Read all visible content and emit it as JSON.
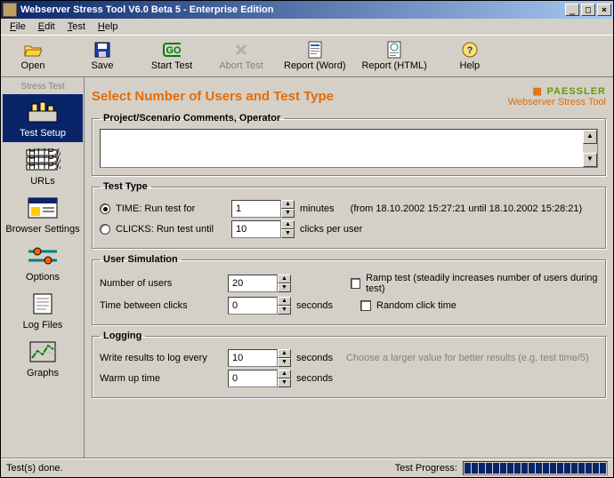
{
  "window": {
    "title": "Webserver Stress Tool V6.0 Beta 5 - Enterprise Edition"
  },
  "menu": {
    "file": "File",
    "edit": "Edit",
    "test": "Test",
    "help": "Help"
  },
  "toolbar": {
    "open": "Open",
    "save": "Save",
    "start": "Start Test",
    "abort": "Abort Test",
    "rword": "Report (Word)",
    "rhtml": "Report (HTML)",
    "help": "Help"
  },
  "sidebar": {
    "stress": "Stress Test",
    "setup": "Test Setup",
    "urls": "URLs",
    "browser": "Browser Settings",
    "options": "Options",
    "logs": "Log Files",
    "graphs": "Graphs"
  },
  "header": {
    "title": "Select Number of Users and Test Type",
    "brand1": "PAESSLER",
    "brand2": "Webserver Stress Tool"
  },
  "comments": {
    "legend": "Project/Scenario Comments, Operator"
  },
  "testtype": {
    "legend": "Test Type",
    "time_label": "TIME: Run test for",
    "time_value": "1",
    "time_unit": "minutes",
    "time_range": "(from 18.10.2002 15:27:21 until 18.10.2002 15:28:21)",
    "clicks_label": "CLICKS: Run test until",
    "clicks_value": "10",
    "clicks_unit": "clicks per user"
  },
  "usersim": {
    "legend": "User Simulation",
    "num_label": "Number of users",
    "num_value": "20",
    "ramp_label": "Ramp test (steadily increases number of users during test)",
    "between_label": "Time between clicks",
    "between_value": "0",
    "between_unit": "seconds",
    "random_label": "Random click time"
  },
  "logging": {
    "legend": "Logging",
    "every_label": "Write results to log every",
    "every_value": "10",
    "every_unit": "seconds",
    "hint": "Choose a larger value for better results (e.g. test time/5)",
    "warm_label": "Warm up time",
    "warm_value": "0",
    "warm_unit": "seconds"
  },
  "status": {
    "left": "Test(s) done.",
    "right": "Test Progress:"
  }
}
